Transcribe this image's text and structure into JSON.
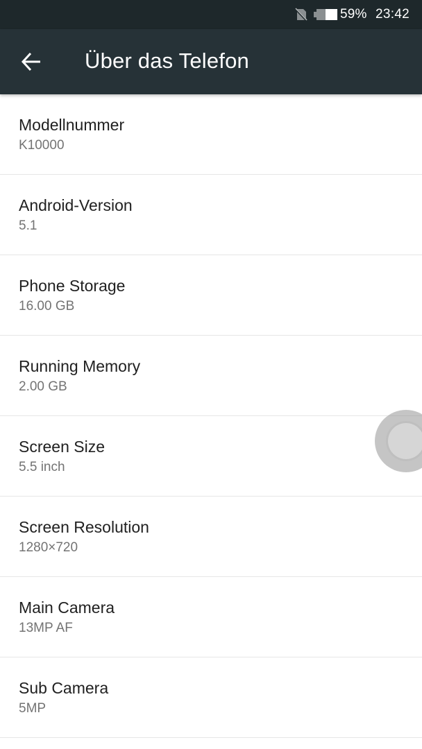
{
  "status_bar": {
    "icons": [
      "no-sim-icon",
      "battery-icon"
    ],
    "battery_percent": "59%",
    "time": "23:42"
  },
  "app_bar": {
    "back_icon": "arrow-left-icon",
    "title": "Über das Telefon"
  },
  "items": [
    {
      "title": "Modellnummer",
      "value": "K10000"
    },
    {
      "title": "Android-Version",
      "value": "5.1"
    },
    {
      "title": "Phone Storage",
      "value": "16.00 GB"
    },
    {
      "title": "Running Memory",
      "value": "2.00 GB"
    },
    {
      "title": "Screen Size",
      "value": "5.5 inch"
    },
    {
      "title": "Screen Resolution",
      "value": "1280×720"
    },
    {
      "title": "Main Camera",
      "value": "13MP AF"
    },
    {
      "title": "Sub Camera",
      "value": "5MP"
    }
  ],
  "colors": {
    "status_bar_bg": "#1e282b",
    "app_bar_bg": "#263237",
    "title_text": "#212121",
    "value_text": "#737373",
    "divider": "#e6e6e6"
  }
}
